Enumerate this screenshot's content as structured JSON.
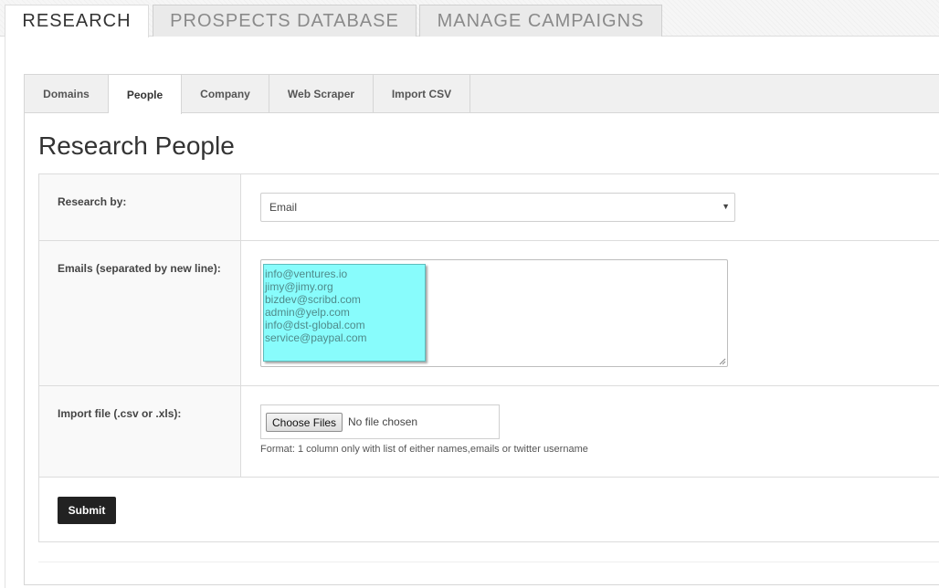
{
  "top_tabs": [
    {
      "label": "RESEARCH",
      "active": true
    },
    {
      "label": "PROSPECTS DATABASE",
      "active": false
    },
    {
      "label": "MANAGE CAMPAIGNS",
      "active": false
    }
  ],
  "sub_tabs": [
    {
      "label": "Domains",
      "active": false
    },
    {
      "label": "People",
      "active": true
    },
    {
      "label": "Company",
      "active": false
    },
    {
      "label": "Web Scraper",
      "active": false
    },
    {
      "label": "Import CSV",
      "active": false
    }
  ],
  "page_title": "Research People",
  "form": {
    "research_by": {
      "label": "Research by:",
      "selected": "Email",
      "caret_icon": "chevron-down-icon"
    },
    "emails": {
      "label": "Emails (separated by new line):",
      "lines": [
        "info@ventures.io",
        "jimy@jimy.org",
        "bizdev@scribd.com",
        "admin@yelp.com",
        "info@dst-global.com",
        "service@paypal.com"
      ],
      "selection_color": "#88fcfc"
    },
    "import_file": {
      "label": "Import file (.csv or .xls):",
      "button_label": "Choose Files",
      "status": "No file chosen",
      "help": "Format: 1 column only with list of either names,emails or twitter username"
    },
    "submit_label": "Submit"
  },
  "colors": {
    "submit_bg": "#222222",
    "tab_bar_bg": "#f0f0f0"
  }
}
